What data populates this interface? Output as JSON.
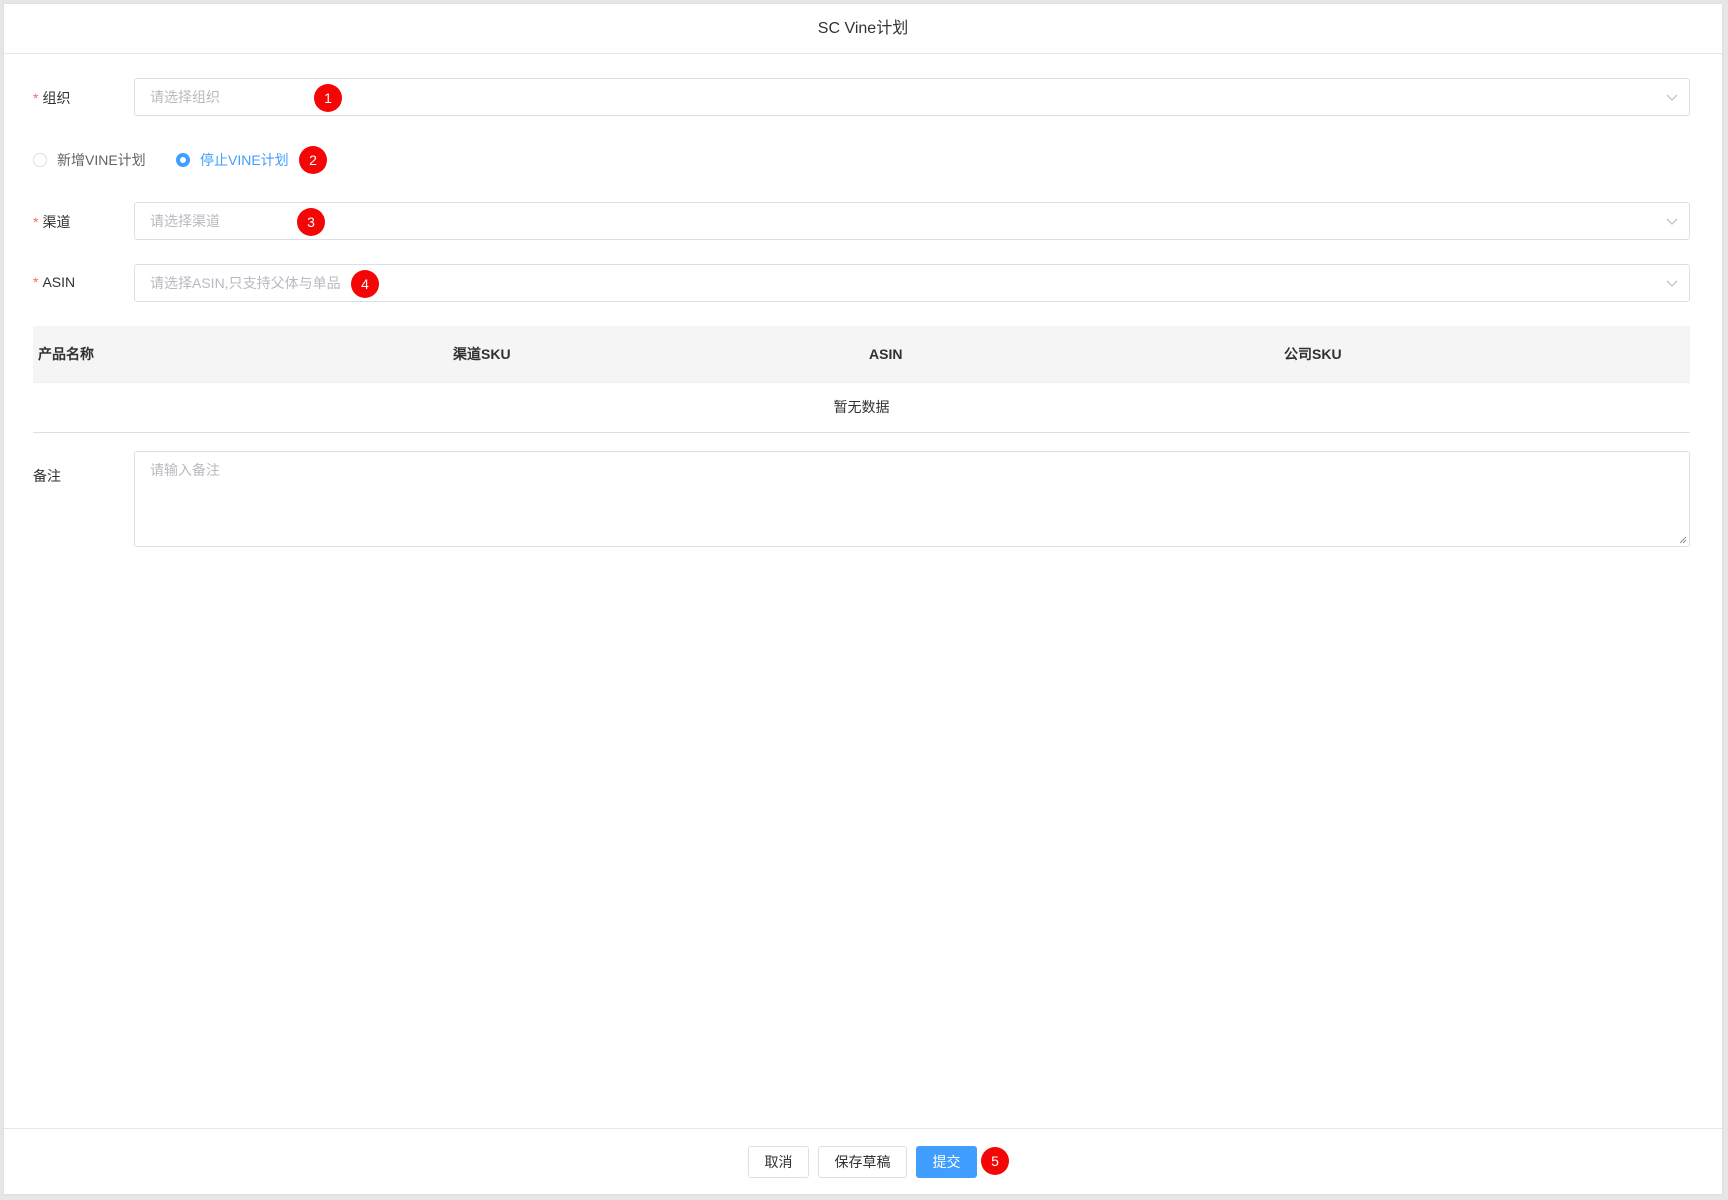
{
  "dialog": {
    "title": "SC Vine计划"
  },
  "form": {
    "org": {
      "label": "组织",
      "placeholder": "请选择组织",
      "required": true
    },
    "plan_type": {
      "options": [
        {
          "label": "新增VINE计划",
          "checked": false
        },
        {
          "label": "停止VINE计划",
          "checked": true
        }
      ]
    },
    "channel": {
      "label": "渠道",
      "placeholder": "请选择渠道",
      "required": true
    },
    "asin": {
      "label": "ASIN",
      "placeholder": "请选择ASIN,只支持父体与单品",
      "required": true
    },
    "remark": {
      "label": "备注",
      "placeholder": "请输入备注"
    }
  },
  "table": {
    "columns": [
      "产品名称",
      "渠道SKU",
      "ASIN",
      "公司SKU"
    ],
    "empty_text": "暂无数据"
  },
  "footer": {
    "cancel": "取消",
    "save_draft": "保存草稿",
    "submit": "提交"
  },
  "annotations": [
    "1",
    "2",
    "3",
    "4",
    "5"
  ],
  "colors": {
    "primary": "#409eff",
    "required_star": "#f56c6c",
    "annotation_badge": "#f50606"
  }
}
